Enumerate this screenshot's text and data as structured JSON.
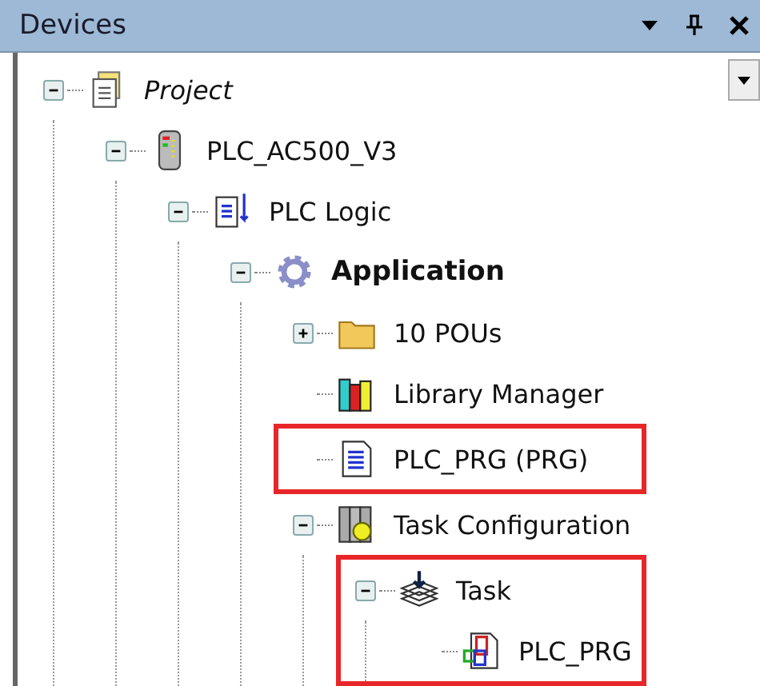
{
  "panel": {
    "title": "Devices"
  },
  "tree": [
    {
      "label": "Project",
      "kind": "project",
      "expanded": true,
      "highlighted": false,
      "children": [
        {
          "label": "PLC_AC500_V3",
          "kind": "plc",
          "expanded": true,
          "highlighted": false,
          "children": [
            {
              "label": "PLC Logic",
              "kind": "logic",
              "expanded": true,
              "highlighted": false,
              "children": [
                {
                  "label": "Application",
                  "kind": "app",
                  "expanded": true,
                  "highlighted": false,
                  "children": [
                    {
                      "label": "10 POUs",
                      "kind": "folder",
                      "expanded": false,
                      "highlighted": false
                    },
                    {
                      "label": "Library Manager",
                      "kind": "library",
                      "highlighted": false
                    },
                    {
                      "label": "PLC_PRG (PRG)",
                      "kind": "prg",
                      "highlighted": true
                    },
                    {
                      "label": "Task Configuration",
                      "kind": "taskconfig",
                      "expanded": true,
                      "highlighted": false,
                      "children": [
                        {
                          "label": "Task",
                          "kind": "task",
                          "expanded": true,
                          "highlighted": true,
                          "children": [
                            {
                              "label": "PLC_PRG",
                              "kind": "prgref",
                              "highlighted": false
                            }
                          ]
                        }
                      ]
                    }
                  ]
                }
              ]
            }
          ]
        }
      ]
    }
  ]
}
